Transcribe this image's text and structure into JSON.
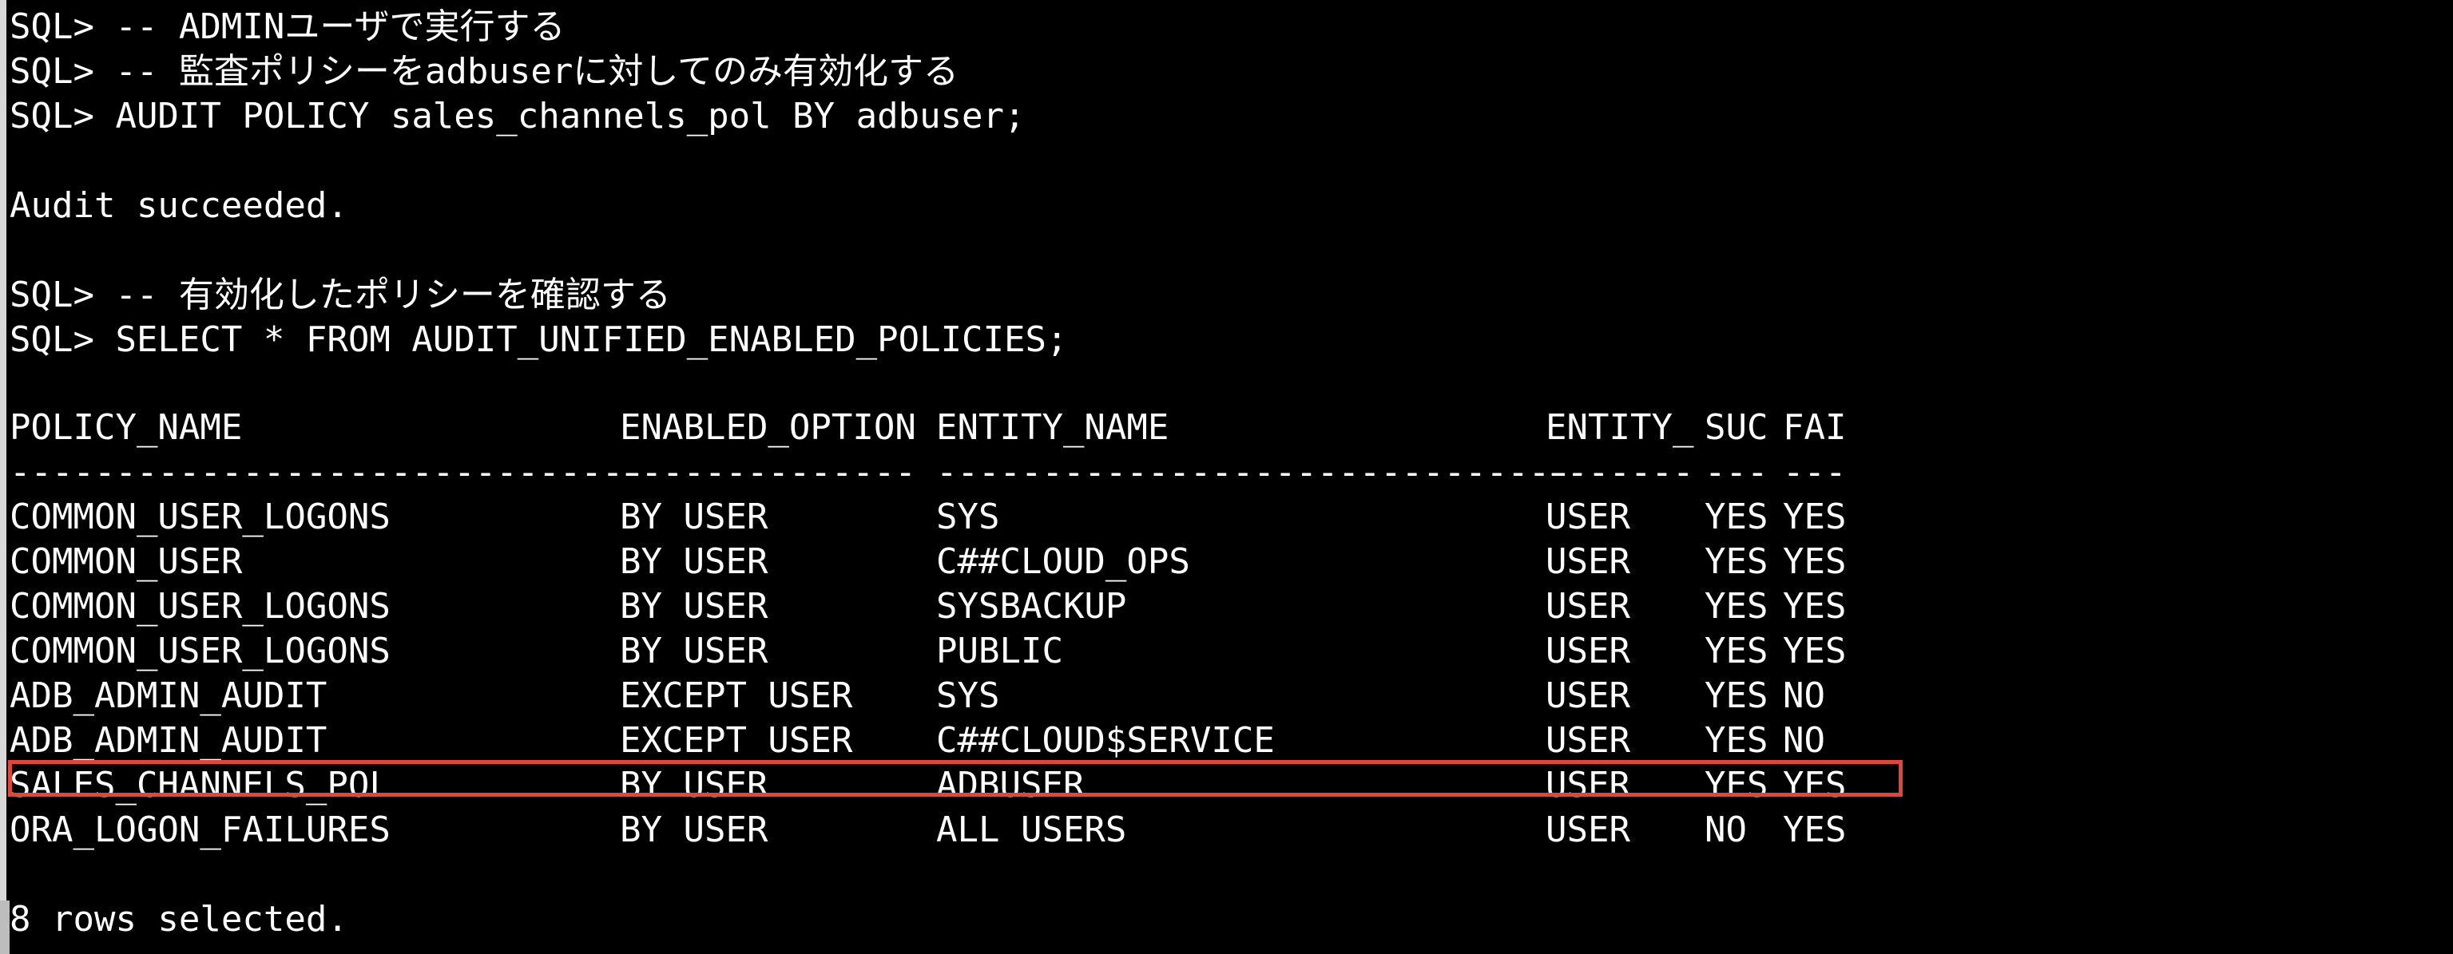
{
  "colors": {
    "background": "#000000",
    "text": "#ffffff",
    "highlight_border": "#e0463a"
  },
  "session": {
    "lines": [
      "SQL> -- ADMINユーザで実行する",
      "SQL> -- 監査ポリシーをadbuserに対してのみ有効化する",
      "SQL> AUDIT POLICY sales_channels_pol BY adbuser;",
      "",
      "Audit succeeded.",
      "",
      "SQL> -- 有効化したポリシーを確認する",
      "SQL> SELECT * FROM AUDIT_UNIFIED_ENABLED_POLICIES;"
    ],
    "footer": "8 rows selected."
  },
  "table": {
    "headers": [
      "POLICY_NAME",
      "ENABLED_OPTION",
      "ENTITY_NAME",
      "ENTITY_",
      "SUC",
      "FAI"
    ],
    "separators": [
      "------------------------------",
      "--------------",
      "------------------------------",
      "-------",
      "---",
      "---"
    ],
    "rows": [
      [
        "COMMON_USER_LOGONS",
        "BY USER",
        "SYS",
        "USER",
        "YES",
        "YES"
      ],
      [
        "COMMON_USER",
        "BY USER",
        "C##CLOUD_OPS",
        "USER",
        "YES",
        "YES"
      ],
      [
        "COMMON_USER_LOGONS",
        "BY USER",
        "SYSBACKUP",
        "USER",
        "YES",
        "YES"
      ],
      [
        "COMMON_USER_LOGONS",
        "BY USER",
        "PUBLIC",
        "USER",
        "YES",
        "YES"
      ],
      [
        "ADB_ADMIN_AUDIT",
        "EXCEPT USER",
        "SYS",
        "USER",
        "YES",
        "NO"
      ],
      [
        "ADB_ADMIN_AUDIT",
        "EXCEPT USER",
        "C##CLOUD$SERVICE",
        "USER",
        "YES",
        "NO"
      ],
      [
        "SALES_CHANNELS_POL",
        "BY USER",
        "ADBUSER",
        "USER",
        "YES",
        "YES"
      ],
      [
        "ORA_LOGON_FAILURES",
        "BY USER",
        "ALL USERS",
        "USER",
        "NO",
        "YES"
      ]
    ],
    "highlighted_row": 6
  }
}
